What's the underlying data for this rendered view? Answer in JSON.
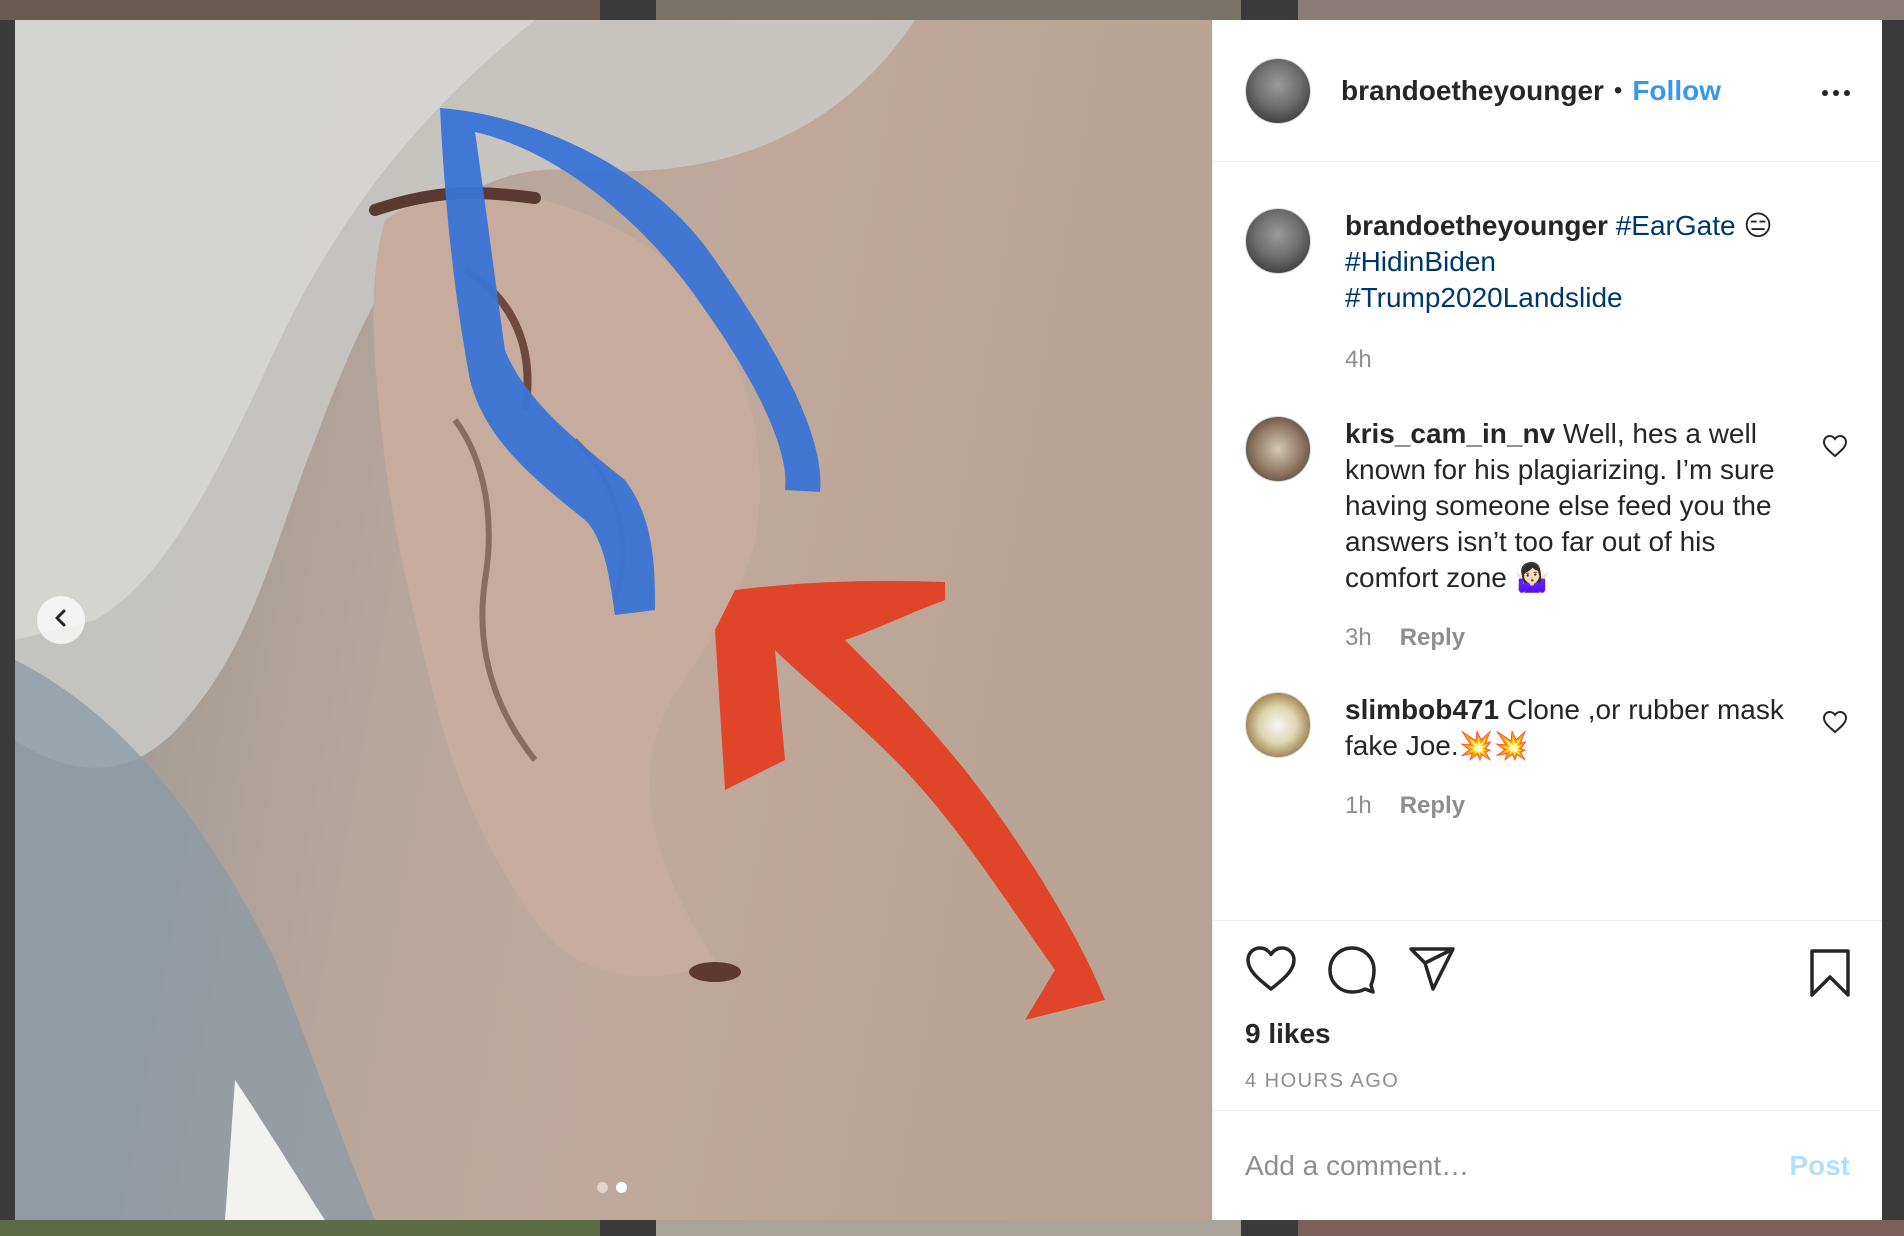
{
  "post": {
    "author": "brandoetheyounger",
    "separator": "•",
    "follow_label": "Follow",
    "caption": {
      "username": "brandoetheyounger",
      "hashtags": [
        "#EarGate",
        "#HidinBiden",
        "#Trump2020Landslide"
      ],
      "emoji": "😑",
      "time": "4h"
    },
    "comments": [
      {
        "username": "kris_cam_in_nv",
        "text": "Well, hes a well known for his plagiarizing. I’m sure having someone else feed you the answers isn’t too far out of his comfort zone 🤷🏻‍♀️",
        "time": "3h",
        "reply_label": "Reply"
      },
      {
        "username": "slimbob471",
        "text": "Clone ,or rubber mask fake Joe.💥💥",
        "time": "1h",
        "reply_label": "Reply"
      }
    ],
    "likes": "9 likes",
    "timestamp": "4 HOURS AGO",
    "add_comment_placeholder": "Add a comment…",
    "post_label": "Post"
  },
  "carousel": {
    "slide_count": 2,
    "active_index": 1
  },
  "icons": {
    "like": "heart-icon",
    "comment": "comment-icon",
    "share": "send-icon",
    "save": "bookmark-icon",
    "prev": "chevron-left-icon",
    "more": "more-options-icon"
  },
  "colors": {
    "follow": "#3797ef",
    "hashtag": "#00376b",
    "arrow_annotation": "#e0452a",
    "outline_annotation": "#3a74d6"
  }
}
